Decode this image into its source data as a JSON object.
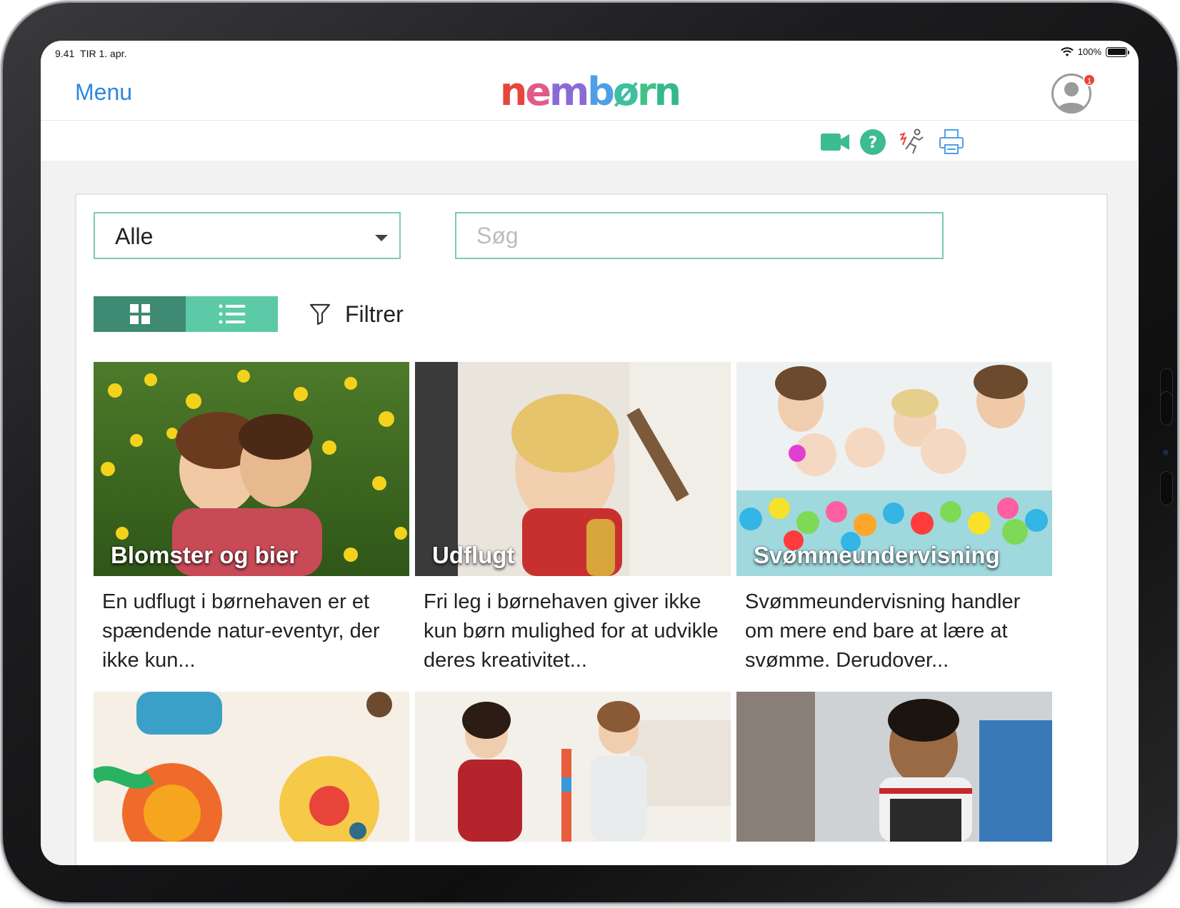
{
  "status_bar": {
    "time": "9.41",
    "date": "TIR 1. apr.",
    "battery": "100%"
  },
  "nav": {
    "menu_label": "Menu",
    "logo_letters": [
      {
        "char": "n",
        "color": "#e8443a"
      },
      {
        "char": "e",
        "color": "#e05a8a"
      },
      {
        "char": "m",
        "color": "#8a6bd6"
      },
      {
        "char": "b",
        "color": "#4f9ee8"
      },
      {
        "char": "ø",
        "color": "#3dbfa0"
      },
      {
        "char": "r",
        "color": "#44c08a"
      },
      {
        "char": "n",
        "color": "#35b98a"
      }
    ],
    "notification_count": "1"
  },
  "toolbar": {
    "icons": [
      "video-camera-icon",
      "help-icon",
      "emergency-exit-icon",
      "print-icon"
    ],
    "accent": "#3dbb93"
  },
  "filters": {
    "select_value": "Alle",
    "search_placeholder": "Søg",
    "filter_label": "Filtrer"
  },
  "view_toggle": {
    "active": "grid",
    "options": [
      "grid",
      "list"
    ]
  },
  "cards": [
    {
      "title": "Blomster og bier",
      "description": "En udflugt i børnehaven er et spændende natur-eventyr, der ikke kun..."
    },
    {
      "title": "Udflugt",
      "description": "Fri leg i børnehaven giver ikke kun børn mulighed for at udvikle deres kreativitet..."
    },
    {
      "title": "Svømmeundervisning",
      "description": "Svømmeundervisning handler om mere end bare at lære at svømme. Derudover..."
    },
    {
      "title": "",
      "description": ""
    },
    {
      "title": "",
      "description": ""
    },
    {
      "title": "",
      "description": ""
    }
  ]
}
